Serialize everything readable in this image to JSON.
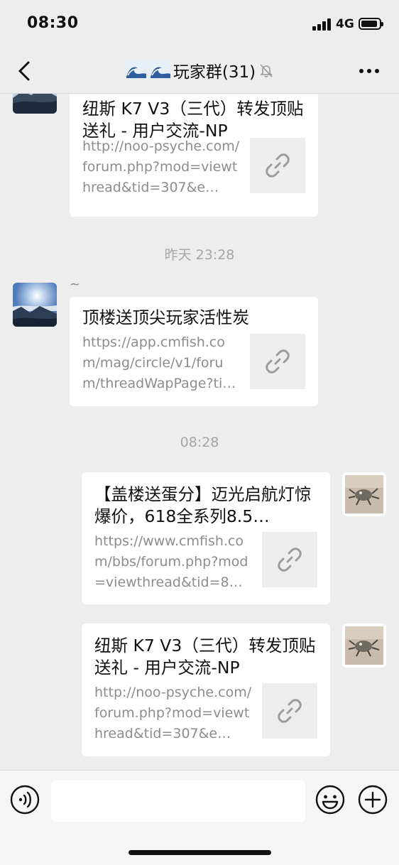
{
  "status_bar": {
    "time": "08:30",
    "network": "4G"
  },
  "nav": {
    "title": "玩家群(31)",
    "title_icon": "wave-emoji-icon",
    "muted_icon": "bell-off-icon"
  },
  "chat": {
    "messages": [
      {
        "side": "left",
        "title": "纽斯 K7 V3（三代）转发顶贴送礼 - 用户交流-NP",
        "url": "http://noo-psyche.com/forum.php?mod=viewthread&tid=307&e…"
      },
      {
        "timestamp": "昨天 23:28"
      },
      {
        "side": "left",
        "sender": "~",
        "title": "顶楼送顶尖玩家活性炭",
        "url": "https://app.cmfish.com/mag/circle/v1/forum/threadWapPage?tid…"
      },
      {
        "timestamp": "08:28"
      },
      {
        "side": "right",
        "title": "【盖楼送蛋分】迈光启航灯惊爆价，618全系列8.5…",
        "url": "https://www.cmfish.com/bbs/forum.php?mod=viewthread&tid=8…"
      },
      {
        "side": "right",
        "title": "纽斯 K7 V3（三代）转发顶贴送礼 - 用户交流-NP",
        "url": "http://noo-psyche.com/forum.php?mod=viewthread&tid=307&e…"
      }
    ]
  },
  "input": {
    "placeholder": "",
    "voice_icon": "voice-icon",
    "emoji_icon": "emoji-icon",
    "plus_icon": "plus-icon"
  },
  "colors": {
    "background": "#ededed",
    "bubble": "#ffffff",
    "muted_text": "#8c8c8c",
    "timestamp": "#a6a6a6"
  }
}
